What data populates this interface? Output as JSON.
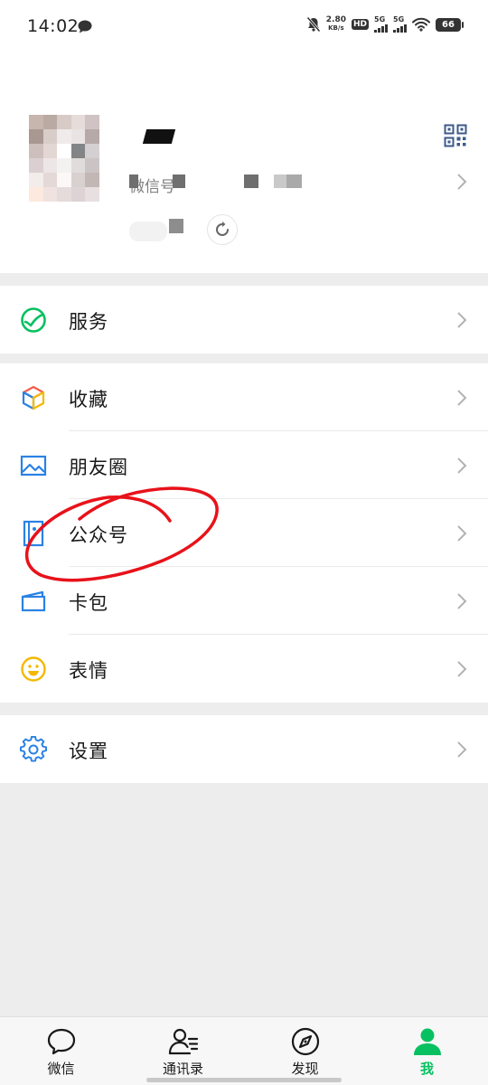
{
  "status_bar": {
    "time": "14:02",
    "net_speed_value": "2.80",
    "net_speed_unit": "KB/s",
    "hd": "HD",
    "sim1": "5G",
    "sim2": "5G",
    "battery": "66"
  },
  "profile": {
    "nickname": "",
    "wechat_id_prefix": "微信号",
    "icons": [
      "qr-code-icon",
      "chevron-right-icon",
      "refresh-icon"
    ]
  },
  "menu": {
    "services": "服务",
    "favorites": "收藏",
    "moments": "朋友圈",
    "official_accounts": "公众号",
    "card_wallet": "卡包",
    "stickers": "表情",
    "settings": "设置"
  },
  "tabs": {
    "chats": "微信",
    "contacts": "通讯录",
    "discover": "发现",
    "me": "我"
  },
  "colors": {
    "accent_green": "#07c160",
    "icon_blue": "#2a82e4",
    "annotation_red": "#e8121a",
    "background": "#ededed"
  }
}
